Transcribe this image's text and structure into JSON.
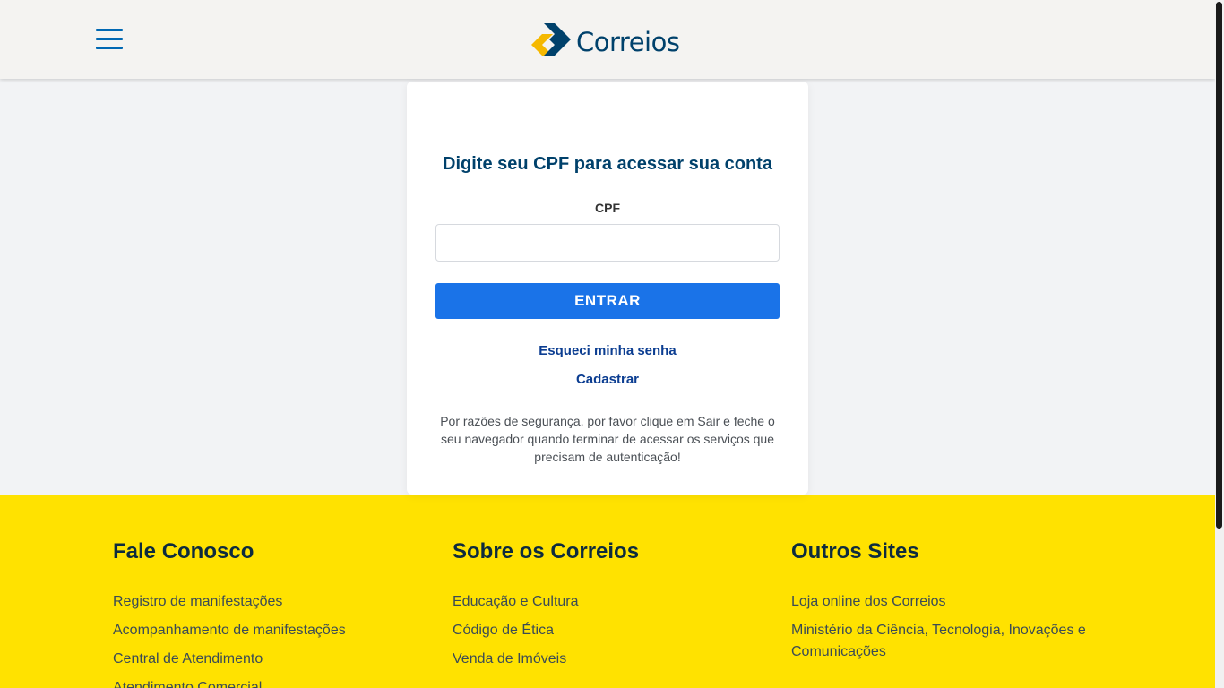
{
  "header": {
    "menu_icon": "hamburger-menu-icon",
    "logo_text": "Correios",
    "colors": {
      "background": "#f4f3f1",
      "menu": "#0068b3",
      "logo_blue": "#00416b",
      "logo_yellow": "#f5b800"
    }
  },
  "login": {
    "title": "Digite seu CPF para acessar sua conta",
    "cpf_label": "CPF",
    "cpf_value": "",
    "cpf_placeholder": "",
    "submit_label": "ENTRAR",
    "forgot_label": "Esqueci minha senha",
    "register_label": "Cadastrar",
    "notice": "Por razões de segurança, por favor clique em Sair e feche o seu navegador quando terminar de acessar os serviços que precisam de autenticação!",
    "colors": {
      "button": "#1a73e8",
      "link": "#0b3d91",
      "title": "#00416b"
    }
  },
  "footer": {
    "background": "#ffe200",
    "columns": [
      {
        "title": "Fale Conosco",
        "items": [
          "Registro de manifestações",
          "Acompanhamento de manifestações",
          "Central de Atendimento",
          "Atendimento Comercial"
        ]
      },
      {
        "title": "Sobre os Correios",
        "items": [
          "Educação e Cultura",
          "Código de Ética",
          "Venda de Imóveis"
        ]
      },
      {
        "title": "Outros Sites",
        "items": [
          "Loja online dos Correios",
          "Ministério da Ciência, Tecnologia, Inovações e Comunicações"
        ]
      }
    ]
  }
}
